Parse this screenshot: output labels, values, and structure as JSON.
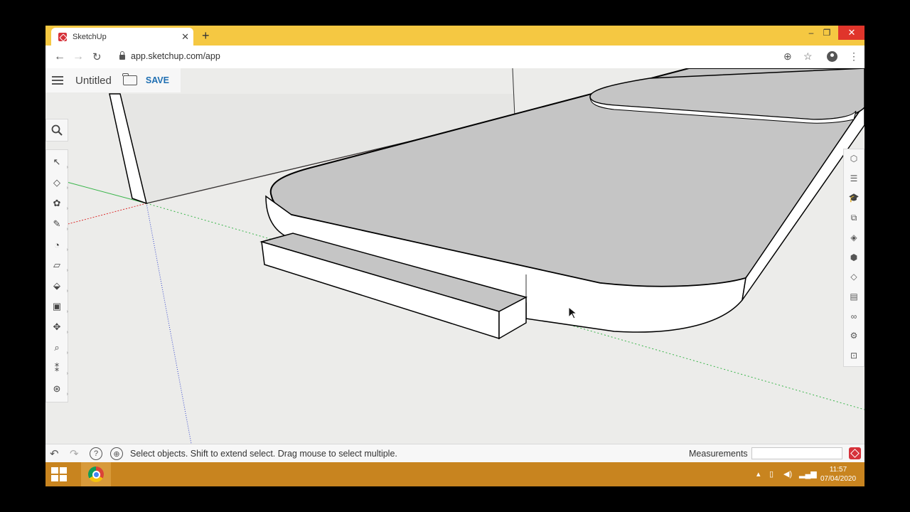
{
  "browser": {
    "tab_title": "SketchUp",
    "tab_close": "✕",
    "new_tab": "+",
    "url": "app.sketchup.com/app",
    "window_min": "–",
    "window_max": "❐",
    "window_close": "✕"
  },
  "app": {
    "document_title": "Untitled",
    "save_label": "SAVE"
  },
  "toolbar": {
    "tools": [
      "select-icon",
      "eraser-icon",
      "paint-bucket-icon",
      "pencil-icon",
      "arc-icon",
      "rectangle-icon",
      "push-pull-icon",
      "offset-icon",
      "move-icon",
      "tape-measure-icon",
      "walk-icon",
      "orbit-icon"
    ]
  },
  "right_panel": {
    "tools": [
      "entity-info-icon",
      "outliner-icon",
      "instructor-icon",
      "components-icon",
      "materials-icon",
      "styles-icon",
      "tags-icon",
      "scenes-icon",
      "display-icon",
      "solar-icon",
      "export-icon"
    ]
  },
  "statusbar": {
    "hint": "Select objects. Shift to extend select. Drag mouse to select multiple.",
    "measurements_label": "Measurements",
    "measurements_value": "",
    "help_glyph": "?"
  },
  "taskbar": {
    "time": "11:57",
    "date": "07/04/2020"
  },
  "colors": {
    "tab_strip": "#f5c842",
    "taskbar": "#c8841f",
    "save_blue": "#1f6fb2",
    "close_red": "#e0352b",
    "sketchup_red": "#d6323a"
  }
}
